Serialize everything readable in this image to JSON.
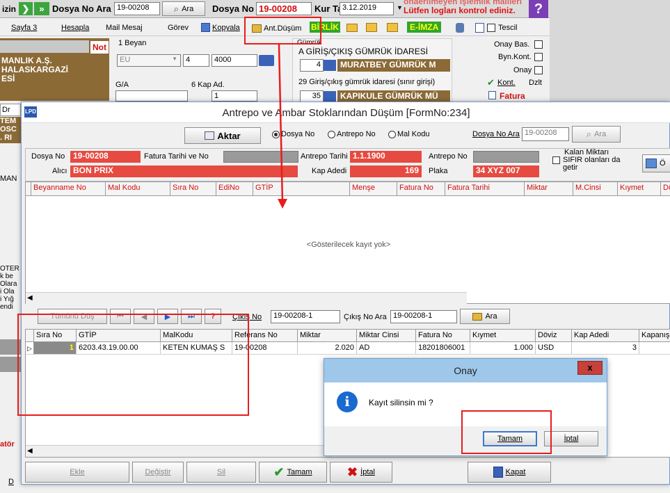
{
  "bg": {
    "izin": "izin",
    "dosya_no_ara_label": "Dosya No Ara",
    "dosya_no_ara_value": "19-00208",
    "ara": "Ara",
    "dosya_no_label": "Dosya No",
    "dosya_no_value": "19-00208",
    "kur_tar_label": "Kur Tar",
    "kur_tar_value": "3.12.2019",
    "warning_line1": "önaerilmeyen işlemlik mailleri",
    "warning_line2": "Lütfen logları kontrol ediniz.",
    "menu": {
      "sayfa3": "Sayfa 3",
      "hesapla": "Hesapla",
      "mail_mesaj": "Mail Mesaj",
      "gorev": "Görev",
      "kopyala": "Kopyala",
      "ant_dusum": "Ant.Düşüm",
      "birlik": "BİRLİK",
      "eimza": "E-İMZA",
      "tescil": "Tescil"
    },
    "not": "Not",
    "beyan_label": "1 Beyan",
    "beyan_value": "EU",
    "beyan_num": "4",
    "beyan_code": "4000",
    "company_line1": "MANLIK A.Ş.",
    "company_line2": "HALASKARGAZİ",
    "company_line3": "ESİ",
    "ga_label": "G/A",
    "kap_ad_label": "6 Kap Ad.",
    "kap_ad_value": "1",
    "gumruk_label": "Gümrük",
    "giris_gumruk_label": "A GİRİŞ/ÇIKIŞ GÜMRÜK İDARESİ",
    "giris_num": "4",
    "giris_name": "MURATBEY GÜMRÜK M",
    "idare29_label": "29 Giriş/çıkış gümrük idaresi (sınır girişi)",
    "idare29_num": "35",
    "idare29_name": "KAPIKULE GÜMRÜK MÜ",
    "onay_bas": "Onay Bas.",
    "byn_kont": "Byn.Kont.",
    "onay": "Onay",
    "kont": "Kont.",
    "dzlt": "Dzlt",
    "fatura": "Fatura",
    "left_frag": [
      "Dr",
      "TEM",
      "OSC",
      ". RI",
      "MAN",
      "OTER",
      "k be",
      "Olara",
      "i Ola",
      "i Yığ",
      "endi"
    ],
    "ator": "atör",
    "bottom_d": "D"
  },
  "form": {
    "title": "Antrepo ve Ambar Stoklarından Düşüm [FormNo:234]",
    "aktar": "Aktar",
    "radio_dosya": "Dosya No",
    "radio_antrepo": "Antrepo No",
    "radio_mal": "Mal Kodu",
    "dosya_no_ara_label": "Dosya No Ara",
    "dosya_no_ara_value": "19-00208",
    "ara": "Ara",
    "dosya_no_label": "Dosya No",
    "dosya_no_value": "19-00208",
    "fatura_tarihi_label": "Fatura Tarihi ve No",
    "antrepo_tarihi_label": "Antrepo Tarihi",
    "antrepo_tarihi_value": "1.1.1900",
    "antrepo_no_label": "Antrepo No",
    "alici_label": "Alıcı",
    "alici_value": "BON PRIX",
    "kap_adedi_label": "Kap Adedi",
    "kap_adedi_value": "169",
    "plaka_label": "Plaka",
    "plaka_value": "34 XYZ 007",
    "kalan_line1": "Kalan Miktarı",
    "kalan_line2": "SIFIR olanları da",
    "kalan_line3": "getir",
    "upper_columns": [
      "Beyanname No",
      "Mal Kodu",
      "Sıra No",
      "EdiNo",
      "GTİP",
      "Menşe",
      "Fatura No",
      "Fatura Tarihi",
      "Miktar",
      "M.Cinsi",
      "Kıymet",
      "Döviz"
    ],
    "empty_text": "<Gösterilecek kayıt yok>",
    "tumunu_dus": "Tümünü Düş",
    "cikis_no_label": "Çıkış No",
    "cikis_no_value": "19-00208-1",
    "cikis_no_ara_label": "Çıkış No Ara",
    "cikis_no_ara_value": "19-00208-1",
    "ara2": "Ara",
    "lower_columns": [
      "Sıra No",
      "GTİP",
      "MalKodu",
      "Referans No",
      "Miktar",
      "Miktar Cinsi",
      "Fatura No",
      "Kıymet",
      "Döviz",
      "Kap Adedi",
      "Kapanış"
    ],
    "lower_row": [
      "1",
      "6203.43.19.00.00",
      "KETEN KUMAŞ S",
      "19-00208",
      "2.020",
      "AD",
      "18201806001",
      "1.000",
      "USD",
      "3",
      ""
    ],
    "ekle": "Ekle",
    "degistir": "Değiştir",
    "sil": "Sil",
    "tamam": "Tamam",
    "iptal": "İptal",
    "kapat": "Kapat"
  },
  "dialog": {
    "title": "Onay",
    "message": "Kayıt silinsin mi ?",
    "tamam": "Tamam",
    "iptal": "İptal",
    "close": "x"
  },
  "colors": {
    "accent_red": "#e64a40",
    "highlight": "#e81c1c",
    "bg_panel": "#f0f0f0",
    "brown": "#8b6a36"
  }
}
